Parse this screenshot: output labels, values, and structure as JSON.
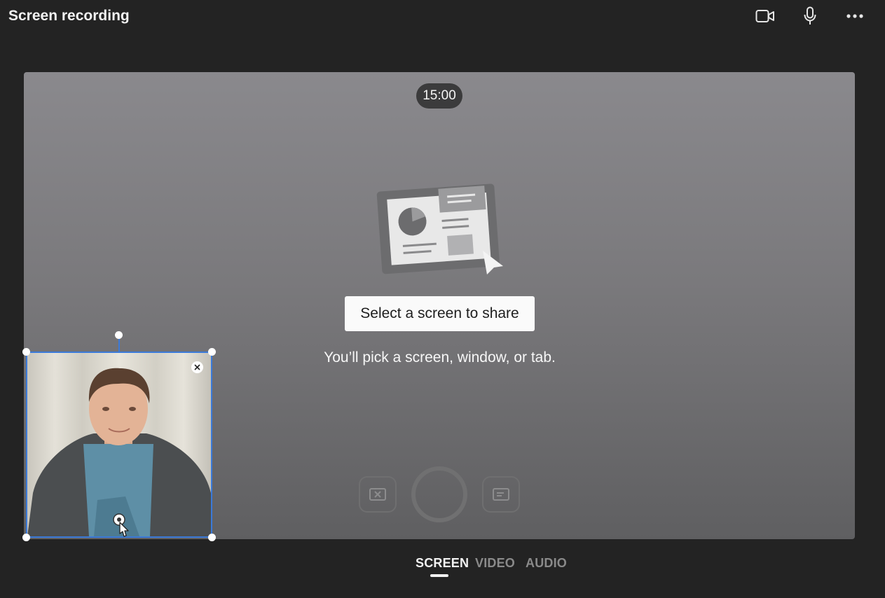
{
  "window": {
    "title": "Screen recording"
  },
  "toolbar": {
    "camera_icon": "video-camera-icon",
    "mic_icon": "microphone-icon",
    "more_icon": "more-icon"
  },
  "stage": {
    "timer": "15:00",
    "share_button": "Select a screen to share",
    "hint": "You’ll pick a screen, window, or tab."
  },
  "controls": {
    "left_icon": "discard-icon",
    "center_icon": "record-icon",
    "right_icon": "captions-icon"
  },
  "tabs": [
    {
      "label": "SCREEN",
      "active": true
    },
    {
      "label": "VIDEO",
      "active": false
    },
    {
      "label": "AUDIO",
      "active": false
    }
  ],
  "colors": {
    "accent_selection": "#3b7ad9",
    "stage_top": "#8a898d",
    "stage_bottom": "#5f5f61",
    "background": "#232323"
  }
}
